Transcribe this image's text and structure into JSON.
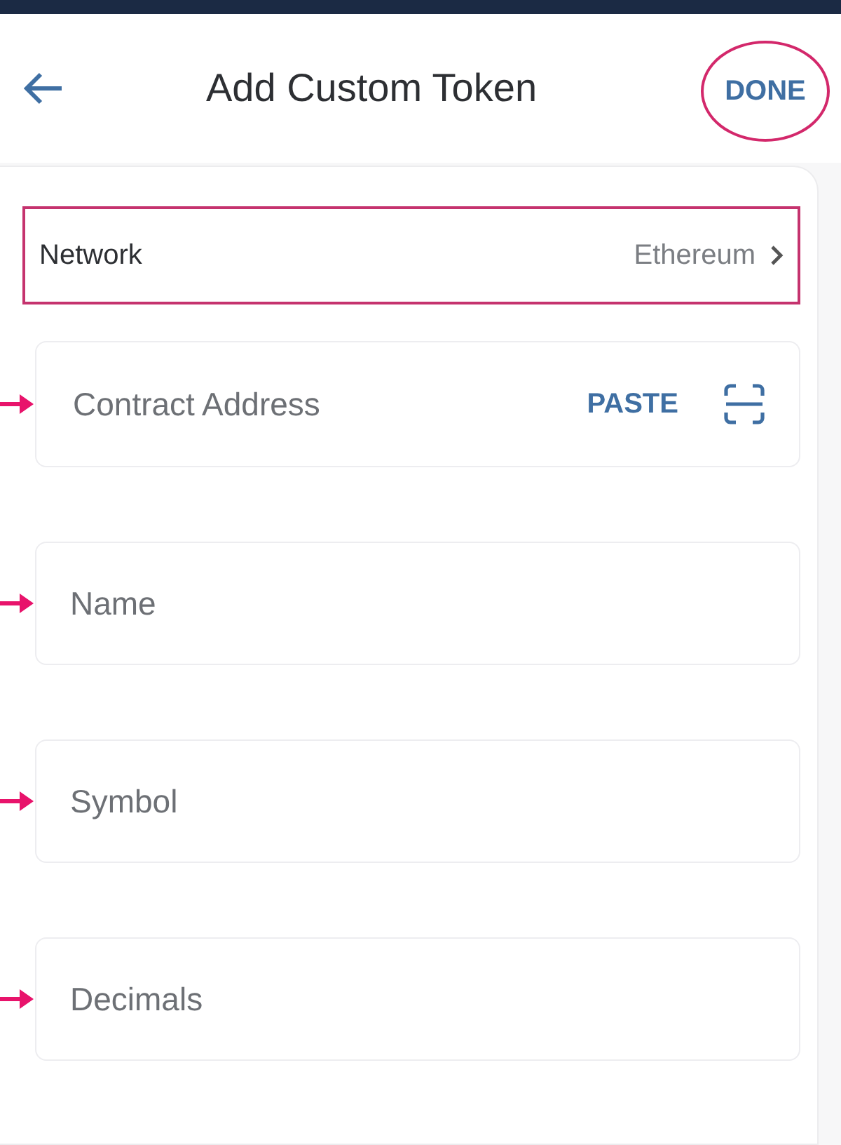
{
  "header": {
    "title": "Add Custom Token",
    "done_button": {
      "label": "DONE",
      "highlighted": true
    }
  },
  "network": {
    "label": "Network",
    "value": "Ethereum",
    "highlighted": true
  },
  "fields": [
    {
      "placeholder": "Contract Address",
      "marked": true,
      "paste_label": "PASTE"
    },
    {
      "placeholder": "Name",
      "marked": true
    },
    {
      "placeholder": "Symbol",
      "marked": true
    },
    {
      "placeholder": "Decimals",
      "marked": true
    }
  ]
}
